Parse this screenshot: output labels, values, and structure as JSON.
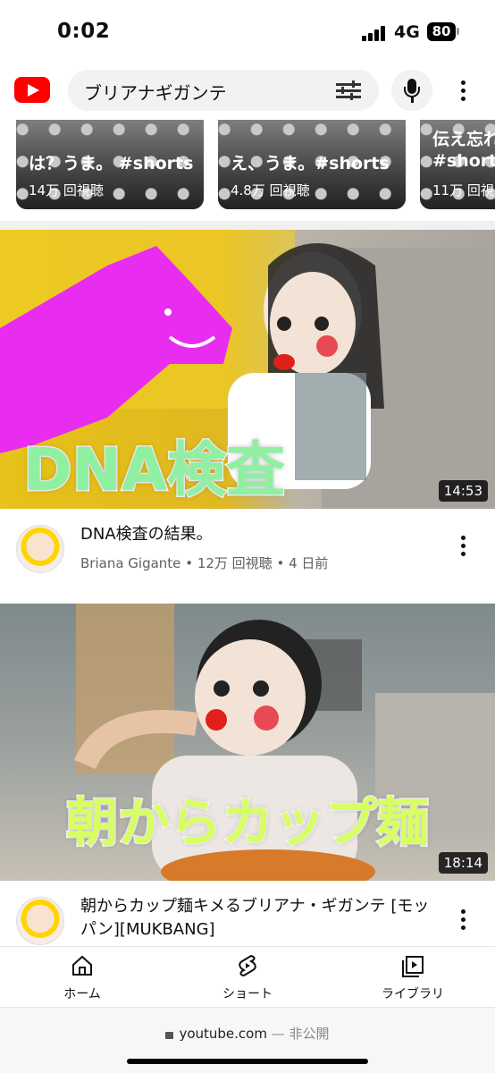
{
  "status_bar": {
    "time": "0:02",
    "network": "4G",
    "battery": "80"
  },
  "search": {
    "query": "ブリアナギガンテ"
  },
  "shorts": [
    {
      "title": "は？うま。 #shorts",
      "views": "14万 回視聴"
    },
    {
      "title": "え、うま。#shorts",
      "views": "4.8万 回視聴"
    },
    {
      "title": "伝え忘れ\n#shorts",
      "views": "11万 回視"
    }
  ],
  "videos": [
    {
      "thumbnail_caption": "DNA検査",
      "duration": "14:53",
      "title": "DNA検査の結果。",
      "channel": "Briana Gigante",
      "views": "12万 回視聴",
      "age": "4 日前"
    },
    {
      "thumbnail_caption": "朝からカップ麺",
      "duration": "18:14",
      "title": "朝からカップ麺キメるブリアナ・ギガンテ [モッパン][MUKBANG]"
    }
  ],
  "bottom_nav": [
    {
      "label": "ホーム",
      "icon": "home-icon"
    },
    {
      "label": "ショート",
      "icon": "shorts-icon"
    },
    {
      "label": "ライブラリ",
      "icon": "library-icon"
    }
  ],
  "browser": {
    "domain": "youtube.com",
    "privacy": "— 非公開"
  },
  "colors": {
    "brand": "#ff0000",
    "meta_text": "#606060",
    "caption_green": "#8ff0a2",
    "caption_lime": "#d8ff61"
  }
}
